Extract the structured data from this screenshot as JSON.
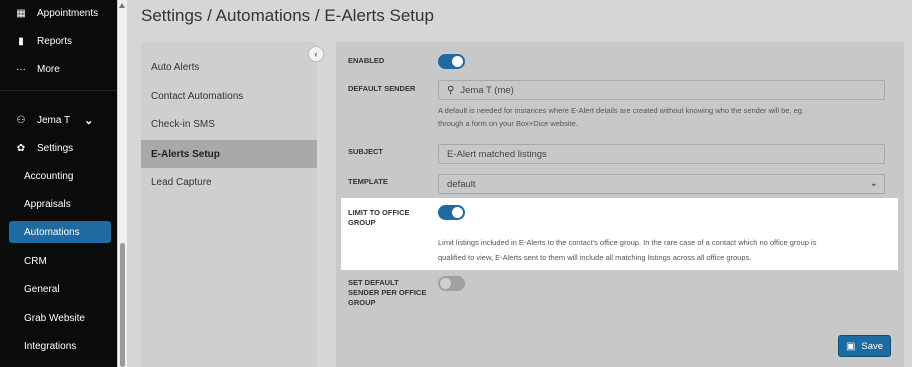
{
  "sidebar": {
    "top_items": [
      {
        "icon": "calendar-icon",
        "glyph": "▦",
        "label": "Appointments"
      },
      {
        "icon": "bar-chart-icon",
        "glyph": "▮",
        "label": "Reports"
      },
      {
        "icon": "more-dots-icon",
        "glyph": "···",
        "label": "More"
      }
    ],
    "user": {
      "icon": "user-icon",
      "glyph": "⚇",
      "label": "Jema T",
      "chevron": "⌄"
    },
    "settings": {
      "icon": "gear-icon",
      "glyph": "✿",
      "label": "Settings"
    },
    "sub_items": [
      "Accounting",
      "Appraisals",
      "Automations",
      "CRM",
      "General",
      "Grab Website",
      "Integrations"
    ],
    "active_sub": "Automations"
  },
  "header": {
    "title": "Settings / Automations / E-Alerts Setup"
  },
  "subnav": {
    "items": [
      "Auto Alerts",
      "Contact Automations",
      "Check-in SMS",
      "E-Alerts Setup",
      "Lead Capture"
    ],
    "active": "E-Alerts Setup",
    "collapse_glyph": "‹"
  },
  "form": {
    "enabled": {
      "label": "ENABLED",
      "value": true
    },
    "default_sender": {
      "label": "DEFAULT SENDER",
      "value": "Jema T (me)",
      "help_line1": "A default is needed for instances where E-Alert details are created without knowing who the sender will be, eg.",
      "help_line2": "through a form on your Box+Dice website."
    },
    "subject": {
      "label": "SUBJECT",
      "value": "E-Alert matched listings"
    },
    "template": {
      "label": "TEMPLATE",
      "value": "default"
    },
    "limit_to_office_group": {
      "label_line1": "LIMIT TO OFFICE",
      "label_line2": "GROUP",
      "value": true,
      "help_line1": "Limit listings included in E-Alerts to the contact's office group. In the rare case of a contact which no office group is",
      "help_line2": "qualified to view, E-Alerts sent to them will include all matching listings across all office groups."
    },
    "set_default_sender_per_office_group": {
      "label_line1": "SET DEFAULT",
      "label_line2": "SENDER PER OFFICE",
      "label_line3": "GROUP",
      "value": false
    }
  },
  "actions": {
    "save_label": "Save"
  },
  "colors": {
    "accent": "#1f6aa0",
    "sidebar_bg": "#0b0b0b"
  }
}
